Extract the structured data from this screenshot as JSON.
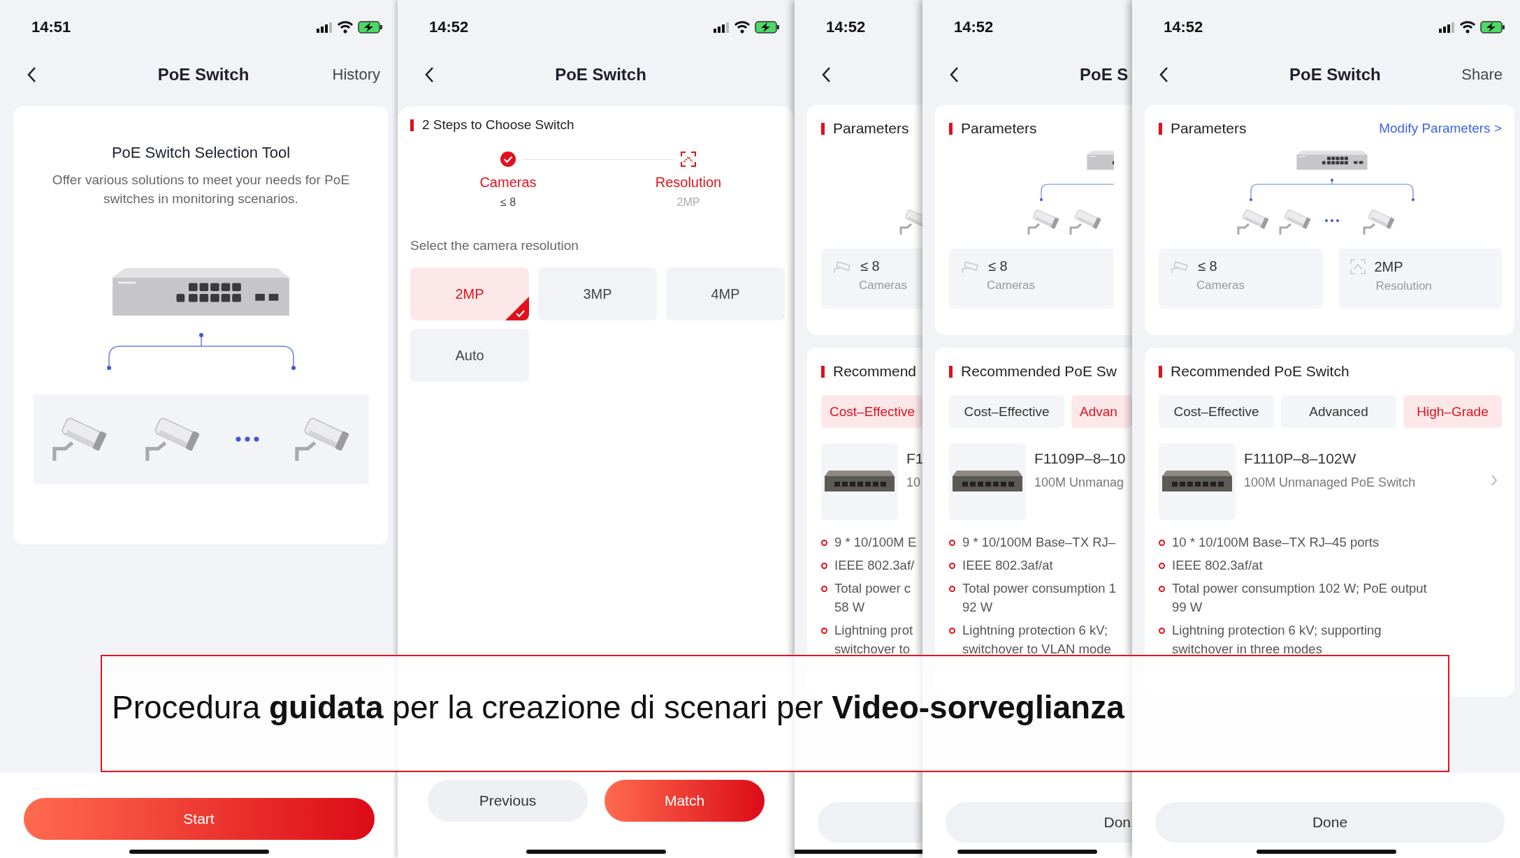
{
  "screens": [
    {
      "kind": "intro",
      "time": "14:51",
      "status_icons": true,
      "title": "PoE Switch",
      "nav_action": "History",
      "heading": "PoE Switch Selection Tool",
      "description": "Offer various solutions to meet your needs for PoE switches in monitoring scenarios.",
      "button": "Start"
    },
    {
      "kind": "steps",
      "time": "14:52",
      "status_icons": true,
      "title": "PoE Switch",
      "section": "2 Steps to Choose Switch",
      "steps": [
        {
          "label": "Cameras",
          "value": "≤ 8",
          "done": true
        },
        {
          "label": "Resolution",
          "value": "2MP",
          "done": false
        }
      ],
      "prompt": "Select the camera resolution",
      "options": [
        {
          "label": "2MP",
          "selected": true
        },
        {
          "label": "3MP",
          "selected": false
        },
        {
          "label": "4MP",
          "selected": false
        },
        {
          "label": "Auto",
          "selected": false
        }
      ],
      "buttons": [
        {
          "label": "Previous",
          "kind": "secondary"
        },
        {
          "label": "Match",
          "kind": "primary"
        }
      ]
    },
    {
      "kind": "result",
      "time": "14:52",
      "status_icons": false,
      "params_title": "Parameters",
      "params": [
        {
          "kind": "cameras",
          "value": "≤ 8",
          "label": "Cameras"
        }
      ],
      "rec_title": "Recommend",
      "tabs": [
        {
          "label": "Cost–Effective",
          "selected": true
        }
      ],
      "product": {
        "name": "F1",
        "description": "10",
        "detail_link": false
      },
      "features": [
        {
          "lines": [
            "9 * 10/100M E"
          ]
        },
        {
          "lines": [
            "IEEE 802.3af/"
          ]
        },
        {
          "lines": [
            "Total power c",
            "58 W"
          ]
        },
        {
          "lines": [
            "Lightning prot",
            "switchover to"
          ]
        }
      ]
    },
    {
      "kind": "result",
      "time": "14:52",
      "status_icons": false,
      "title": "PoE S",
      "params_title": "Parameters",
      "params": [
        {
          "kind": "cameras",
          "value": "≤ 8",
          "label": "Cameras"
        }
      ],
      "rec_title": "Recommended PoE Sw",
      "tabs": [
        {
          "label": "Cost–Effective",
          "selected": false
        },
        {
          "label": "Advan",
          "selected": true
        }
      ],
      "product": {
        "name": "F1109P–8–10",
        "description": "100M Unmanag",
        "detail_link": false
      },
      "features": [
        {
          "lines": [
            "9 * 10/100M Base–TX RJ–"
          ]
        },
        {
          "lines": [
            "IEEE 802.3af/at"
          ]
        },
        {
          "lines": [
            "Total power consumption 1",
            "92 W"
          ]
        },
        {
          "lines": [
            "Lightning protection 6 kV;",
            "switchover to VLAN mode"
          ]
        }
      ],
      "done_label": "Don"
    },
    {
      "kind": "result",
      "time": "14:52",
      "status_icons": true,
      "title": "PoE Switch",
      "nav_action": "Share",
      "params_title": "Parameters",
      "modify_link": "Modify Parameters >",
      "params": [
        {
          "kind": "cameras",
          "value": "≤ 8",
          "label": "Cameras"
        },
        {
          "kind": "resolution",
          "value": "2MP",
          "label": "Resolution"
        }
      ],
      "rec_title": "Recommended PoE Switch",
      "tabs": [
        {
          "label": "Cost–Effective",
          "selected": false
        },
        {
          "label": "Advanced",
          "selected": false
        },
        {
          "label": "High–Grade",
          "selected": true
        }
      ],
      "product": {
        "name": "F1110P–8–102W",
        "description": "100M Unmanaged PoE Switch",
        "detail_link": true
      },
      "features": [
        {
          "lines": [
            "10 * 10/100M Base–TX RJ–45 ports"
          ]
        },
        {
          "lines": [
            "IEEE 802.3af/at"
          ]
        },
        {
          "lines": [
            "Total power consumption 102 W; PoE output",
            "99 W"
          ]
        },
        {
          "lines": [
            "Lightning protection 6 kV; supporting",
            "switchover in three modes"
          ]
        }
      ],
      "done_label": "Done"
    }
  ],
  "caption": "Procedura **guidata** per la creazione di scenari per **Video-sorveglianza**"
}
